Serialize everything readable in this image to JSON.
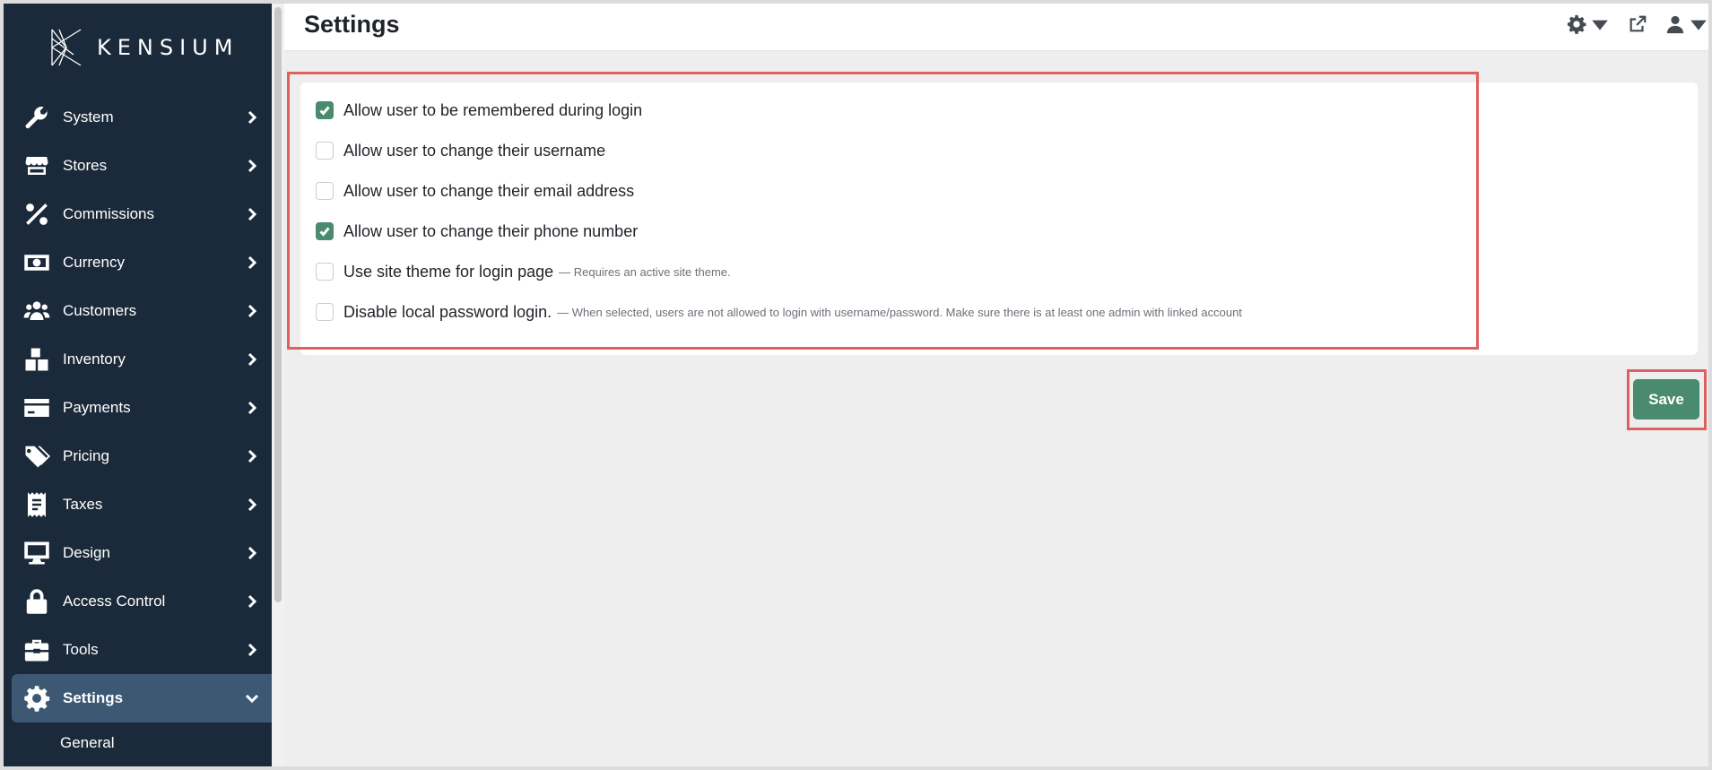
{
  "brand": {
    "name": "KENSIUM"
  },
  "sidebar": {
    "items": [
      {
        "label": "System",
        "icon": "wrench-icon"
      },
      {
        "label": "Stores",
        "icon": "store-icon"
      },
      {
        "label": "Commissions",
        "icon": "percent-icon"
      },
      {
        "label": "Currency",
        "icon": "money-bill-icon"
      },
      {
        "label": "Customers",
        "icon": "users-icon"
      },
      {
        "label": "Inventory",
        "icon": "boxes-icon"
      },
      {
        "label": "Payments",
        "icon": "credit-card-icon"
      },
      {
        "label": "Pricing",
        "icon": "tags-icon"
      },
      {
        "label": "Taxes",
        "icon": "receipt-icon"
      },
      {
        "label": "Design",
        "icon": "desktop-icon"
      },
      {
        "label": "Access Control",
        "icon": "lock-icon"
      },
      {
        "label": "Tools",
        "icon": "toolbox-icon"
      },
      {
        "label": "Settings",
        "icon": "gear-icon",
        "active": true
      }
    ],
    "subitems": [
      {
        "label": "General"
      }
    ]
  },
  "header": {
    "title": "Settings",
    "icons": [
      "gear-icon",
      "external-link-icon",
      "user-icon"
    ]
  },
  "settings": {
    "options": [
      {
        "label": "Allow user to be remembered during login",
        "checked": true,
        "hint": ""
      },
      {
        "label": "Allow user to change their username",
        "checked": false,
        "hint": ""
      },
      {
        "label": "Allow user to change their email address",
        "checked": false,
        "hint": ""
      },
      {
        "label": "Allow user to change their phone number",
        "checked": true,
        "hint": ""
      },
      {
        "label": "Use site theme for login page",
        "checked": false,
        "hint": "— Requires an active site theme."
      },
      {
        "label": "Disable local password login.",
        "checked": false,
        "hint": "— When selected, users are not allowed to login with username/password. Make sure there is at least one admin with linked account"
      }
    ]
  },
  "actions": {
    "save_label": "Save"
  },
  "colors": {
    "sidebar_bg": "#1b2a3a",
    "sidebar_active": "#3d5873",
    "accent": "#4a8a6f",
    "highlight": "#e06060"
  }
}
